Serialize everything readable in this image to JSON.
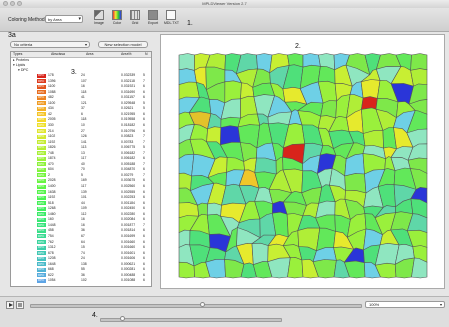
{
  "window": {
    "title": "MPLDViewer Version 2.7"
  },
  "toolbar": {
    "coloring_label": "Coloring Method:",
    "coloring_value": "by Area",
    "buttons": [
      {
        "label": "Image",
        "icon": "image-icon"
      },
      {
        "label": "Color",
        "icon": "palette-icon"
      },
      {
        "label": "Grid",
        "icon": "grid-icon"
      },
      {
        "label": "Export",
        "icon": "export-icon"
      },
      {
        "label": "MDL.TXT",
        "icon": "text-file-icon"
      }
    ]
  },
  "annotations": {
    "a1": "1.",
    "a2": "2.",
    "a3a": "3a",
    "a3": "3.",
    "a4": "4."
  },
  "left": {
    "filter_value": "No criteria",
    "new_selection_label": "New selection model",
    "columns": [
      "Types",
      "Abscissa",
      "Area",
      "Area%",
      "N"
    ],
    "tree": [
      "Proteins",
      "Lipids",
      "DPC"
    ],
    "rows": [
      {
        "color": "#d8241b",
        "name": "DPC",
        "v1": "178",
        "v2": "24",
        "v3": "0.032339",
        "v4": "5"
      },
      {
        "color": "#dd3a1d",
        "name": "DPC",
        "v1": "1396",
        "v2": "107",
        "v3": "0.032118",
        "v4": "7"
      },
      {
        "color": "#e2541e",
        "name": "DPC",
        "v1": "1100",
        "v2": "16",
        "v3": "0.031921",
        "v4": "6"
      },
      {
        "color": "#e76d20",
        "name": "DPC",
        "v1": "1088",
        "v2": "118",
        "v3": "0.031690",
        "v4": "6"
      },
      {
        "color": "#ec8322",
        "name": "DPC",
        "v1": "482",
        "v2": "41",
        "v3": "0.031157",
        "v4": "6"
      },
      {
        "color": "#f09c24",
        "name": "DPC",
        "v1": "1100",
        "v2": "121",
        "v3": "0.029548",
        "v4": "5"
      },
      {
        "color": "#f3b126",
        "name": "DPC",
        "v1": "434",
        "v2": "37",
        "v3": "0.02621",
        "v4": "5"
      },
      {
        "color": "#f6c528",
        "name": "DPC",
        "v1": "42",
        "v2": "6",
        "v3": "0.021955",
        "v4": "6"
      },
      {
        "color": "#f4d82a",
        "name": "DPC",
        "v1": "2005",
        "v2": "118",
        "v3": "0.019558",
        "v4": "6"
      },
      {
        "color": "#eee12c",
        "name": "DPC",
        "v1": "330",
        "v2": "10",
        "v3": "0.018182",
        "v4": "6"
      },
      {
        "color": "#e1e62e",
        "name": "DPC",
        "v1": "214",
        "v2": "27",
        "v3": "0.010796",
        "v4": "6"
      },
      {
        "color": "#d2e930",
        "name": "DPC",
        "v1": "1102",
        "v2": "126",
        "v3": "0.00823",
        "v4": "7"
      },
      {
        "color": "#c5ec32",
        "name": "DPC",
        "v1": "1192",
        "v2": "141",
        "v3": "0.00783",
        "v4": "7"
      },
      {
        "color": "#b6ee35",
        "name": "DPC",
        "v1": "1826",
        "v2": "113",
        "v3": "0.006775",
        "v4": "5"
      },
      {
        "color": "#a8f037",
        "name": "DPC",
        "v1": "748",
        "v2": "13",
        "v3": "0.006182",
        "v4": "7"
      },
      {
        "color": "#9bf239",
        "name": "DPC",
        "v1": "1874",
        "v2": "117",
        "v3": "0.006182",
        "v4": "6"
      },
      {
        "color": "#8ef33b",
        "name": "DPC",
        "v1": "470",
        "v2": "40",
        "v3": "0.005188",
        "v4": "7"
      },
      {
        "color": "#82f43d",
        "name": "DPC",
        "v1": "604",
        "v2": "70",
        "v3": "0.004870",
        "v4": "6"
      },
      {
        "color": "#76f540",
        "name": "DPC",
        "v1": "2",
        "v2": "5",
        "v3": "0.00279",
        "v4": "7"
      },
      {
        "color": "#6af543",
        "name": "DPC",
        "v1": "2028",
        "v2": "169",
        "v3": "0.003675",
        "v4": "6"
      },
      {
        "color": "#5ff547",
        "name": "DPC",
        "v1": "1400",
        "v2": "117",
        "v3": "0.002560",
        "v4": "6"
      },
      {
        "color": "#55f44c",
        "name": "DPC",
        "v1": "1638",
        "v2": "139",
        "v3": "0.002555",
        "v4": "6"
      },
      {
        "color": "#4cf352",
        "name": "DPC",
        "v1": "1192",
        "v2": "101",
        "v3": "0.002253",
        "v4": "6"
      },
      {
        "color": "#45f158",
        "name": "DPC",
        "v1": "518",
        "v2": "44",
        "v3": "0.001184",
        "v4": "6"
      },
      {
        "color": "#40ef60",
        "name": "DPC",
        "v1": "1268",
        "v2": "109",
        "v3": "0.002450",
        "v4": "6"
      },
      {
        "color": "#3cec69",
        "name": "DPC",
        "v1": "1460",
        "v2": "112",
        "v3": "0.002280",
        "v4": "6"
      },
      {
        "color": "#39e873",
        "name": "DPC",
        "v1": "160",
        "v2": "16",
        "v3": "0.002084",
        "v4": "6"
      },
      {
        "color": "#38e47d",
        "name": "DPC",
        "v1": "1448",
        "v2": "16",
        "v3": "0.001877",
        "v4": "7"
      },
      {
        "color": "#38df88",
        "name": "DPC",
        "v1": "458",
        "v2": "36",
        "v3": "0.001814",
        "v4": "6"
      },
      {
        "color": "#39da93",
        "name": "DPC",
        "v1": "754",
        "v2": "67",
        "v3": "0.001699",
        "v4": "6"
      },
      {
        "color": "#3bd49e",
        "name": "DPC",
        "v1": "762",
        "v2": "64",
        "v3": "0.001660",
        "v4": "6"
      },
      {
        "color": "#3ecea9",
        "name": "DPC",
        "v1": "1312",
        "v2": "15",
        "v3": "0.001660",
        "v4": "6"
      },
      {
        "color": "#42c8b4",
        "name": "DPC",
        "v1": "678",
        "v2": "74",
        "v3": "0.001601",
        "v4": "6"
      },
      {
        "color": "#46c2bf",
        "name": "DPC",
        "v1": "1208",
        "v2": "24",
        "v3": "0.001606",
        "v4": "6"
      },
      {
        "color": "#4bbbca",
        "name": "DPC",
        "v1": "1648",
        "v2": "138",
        "v3": "0.000621",
        "v4": "6"
      },
      {
        "color": "#51b4d4",
        "name": "DPC",
        "v1": "668",
        "v2": "55",
        "v3": "0.000281",
        "v4": "6"
      },
      {
        "color": "#57acdd",
        "name": "DPC",
        "v1": "622",
        "v2": "36",
        "v3": "0.000488",
        "v4": "6"
      },
      {
        "color": "#5da4e5",
        "name": "DPC",
        "v1": "1054",
        "v2": "102",
        "v3": "0.001088",
        "v4": "6"
      }
    ]
  },
  "bottom": {
    "zoom_value": "100%"
  },
  "colors": {
    "hot": "#d8241b",
    "mid": "#8ef33b",
    "cool": "#2a35d8"
  }
}
